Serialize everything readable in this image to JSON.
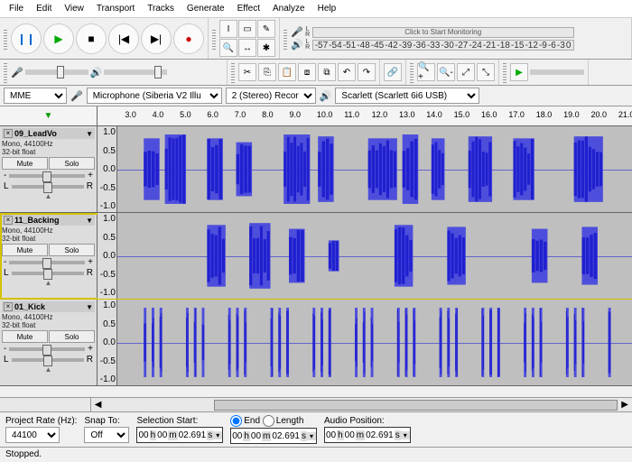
{
  "menu": [
    "File",
    "Edit",
    "View",
    "Transport",
    "Tracks",
    "Generate",
    "Effect",
    "Analyze",
    "Help"
  ],
  "transport": {
    "pause": "❙❙",
    "play": "▶",
    "stop": "■",
    "skip_start": "|◀",
    "skip_end": "▶|",
    "record": "●"
  },
  "meter_ticks": [
    "-57",
    "-54",
    "-51",
    "-48",
    "-45",
    "-42",
    "-39",
    "-36",
    "-33",
    "-30",
    "-27",
    "-24",
    "-21",
    "-18",
    "-15",
    "-12",
    "-9",
    "-6",
    "-3",
    "0"
  ],
  "meter_rec_hint": "Click to Start Monitoring",
  "devices": {
    "host_label": "MME",
    "input": "Microphone (Siberia V2 Illu",
    "channels": "2 (Stereo) Recor",
    "output": "Scarlett (Scarlett 6i6 USB)"
  },
  "ruler_ticks": [
    "3.0",
    "4.0",
    "5.0",
    "6.0",
    "7.0",
    "8.0",
    "9.0",
    "10.0",
    "11.0",
    "12.0",
    "13.0",
    "14.0",
    "15.0",
    "16.0",
    "17.0",
    "18.0",
    "19.0",
    "20.0",
    "21.0"
  ],
  "tracks": [
    {
      "name": "09_LeadVo",
      "info": "Mono, 44100Hz\n32-bit float",
      "mute": "Mute",
      "solo": "Solo",
      "selected": false
    },
    {
      "name": "11_Backing",
      "info": "Mono, 44100Hz\n32-bit float",
      "mute": "Mute",
      "solo": "Solo",
      "selected": true
    },
    {
      "name": "01_Kick",
      "info": "Mono, 44100Hz\n32-bit float",
      "mute": "Mute",
      "solo": "Solo",
      "selected": false
    }
  ],
  "vscale": [
    "1.0",
    "0.5",
    "0.0",
    "-0.5",
    "-1.0"
  ],
  "selection": {
    "rate_label": "Project Rate (Hz):",
    "rate": "44100",
    "snap_label": "Snap To:",
    "snap": "Off",
    "start_label": "Selection Start:",
    "end_label": "End",
    "length_label": "Length",
    "pos_label": "Audio Position:",
    "t_h": "00",
    "t_m": "00",
    "t_s": "02.691",
    "unit": "s",
    "full": "00 h 00 m 02.691 s"
  },
  "status": "Stopped.",
  "chart_data": {
    "type": "waveform",
    "sample_rate": 44100,
    "time_range": [
      2.0,
      21.5
    ],
    "amplitude_range": [
      -1.0,
      1.0
    ],
    "cursor_time": 2.691,
    "tracks": [
      {
        "name": "09_LeadVo",
        "channels": 1,
        "bursts": [
          [
            3.0,
            3.6,
            0.8
          ],
          [
            3.8,
            4.6,
            0.9
          ],
          [
            5.4,
            6.0,
            0.8
          ],
          [
            6.5,
            7.1,
            0.7
          ],
          [
            8.3,
            9.3,
            0.9
          ],
          [
            9.6,
            10.2,
            0.85
          ],
          [
            11.5,
            12.6,
            0.8
          ],
          [
            12.8,
            13.4,
            0.9
          ],
          [
            13.9,
            14.4,
            0.8
          ],
          [
            15.3,
            16.2,
            0.85
          ],
          [
            17.0,
            17.8,
            0.8
          ],
          [
            19.3,
            20.4,
            0.85
          ]
        ]
      },
      {
        "name": "11_Backing",
        "channels": 1,
        "bursts": [
          [
            5.4,
            6.1,
            0.8
          ],
          [
            7.0,
            7.8,
            0.85
          ],
          [
            8.5,
            9.1,
            0.7
          ],
          [
            10.0,
            10.4,
            0.4
          ],
          [
            12.5,
            13.2,
            0.8
          ],
          [
            14.5,
            15.2,
            0.75
          ],
          [
            17.7,
            18.3,
            0.7
          ],
          [
            19.6,
            20.2,
            0.75
          ]
        ]
      },
      {
        "name": "01_Kick",
        "channels": 1,
        "bursts": [
          [
            3.0,
            3.1,
            0.9
          ],
          [
            3.3,
            3.4,
            0.9
          ],
          [
            3.6,
            3.7,
            0.9
          ],
          [
            4.6,
            4.7,
            0.9
          ],
          [
            4.9,
            5.0,
            0.9
          ],
          [
            5.2,
            5.3,
            0.9
          ],
          [
            6.2,
            6.3,
            0.9
          ],
          [
            6.5,
            6.6,
            0.9
          ],
          [
            6.8,
            6.9,
            0.9
          ],
          [
            7.8,
            7.9,
            0.9
          ],
          [
            8.1,
            8.2,
            0.9
          ],
          [
            8.4,
            8.5,
            0.9
          ],
          [
            9.4,
            9.5,
            0.9
          ],
          [
            9.7,
            9.8,
            0.9
          ],
          [
            10.0,
            10.1,
            0.9
          ],
          [
            11.0,
            11.1,
            0.9
          ],
          [
            11.3,
            11.4,
            0.9
          ],
          [
            11.6,
            11.7,
            0.9
          ],
          [
            12.6,
            12.7,
            0.9
          ],
          [
            12.9,
            13.0,
            0.9
          ],
          [
            13.2,
            13.3,
            0.9
          ],
          [
            14.2,
            14.3,
            0.9
          ],
          [
            14.5,
            14.6,
            0.9
          ],
          [
            14.8,
            14.9,
            0.9
          ],
          [
            15.8,
            15.9,
            0.9
          ],
          [
            16.1,
            16.2,
            0.9
          ],
          [
            16.4,
            16.5,
            0.9
          ],
          [
            17.4,
            17.5,
            0.9
          ],
          [
            17.7,
            17.8,
            0.9
          ],
          [
            18.0,
            18.1,
            0.9
          ],
          [
            19.0,
            19.1,
            0.9
          ],
          [
            19.3,
            19.4,
            0.9
          ],
          [
            19.6,
            19.7,
            0.9
          ],
          [
            20.6,
            20.7,
            0.9
          ]
        ]
      }
    ]
  }
}
